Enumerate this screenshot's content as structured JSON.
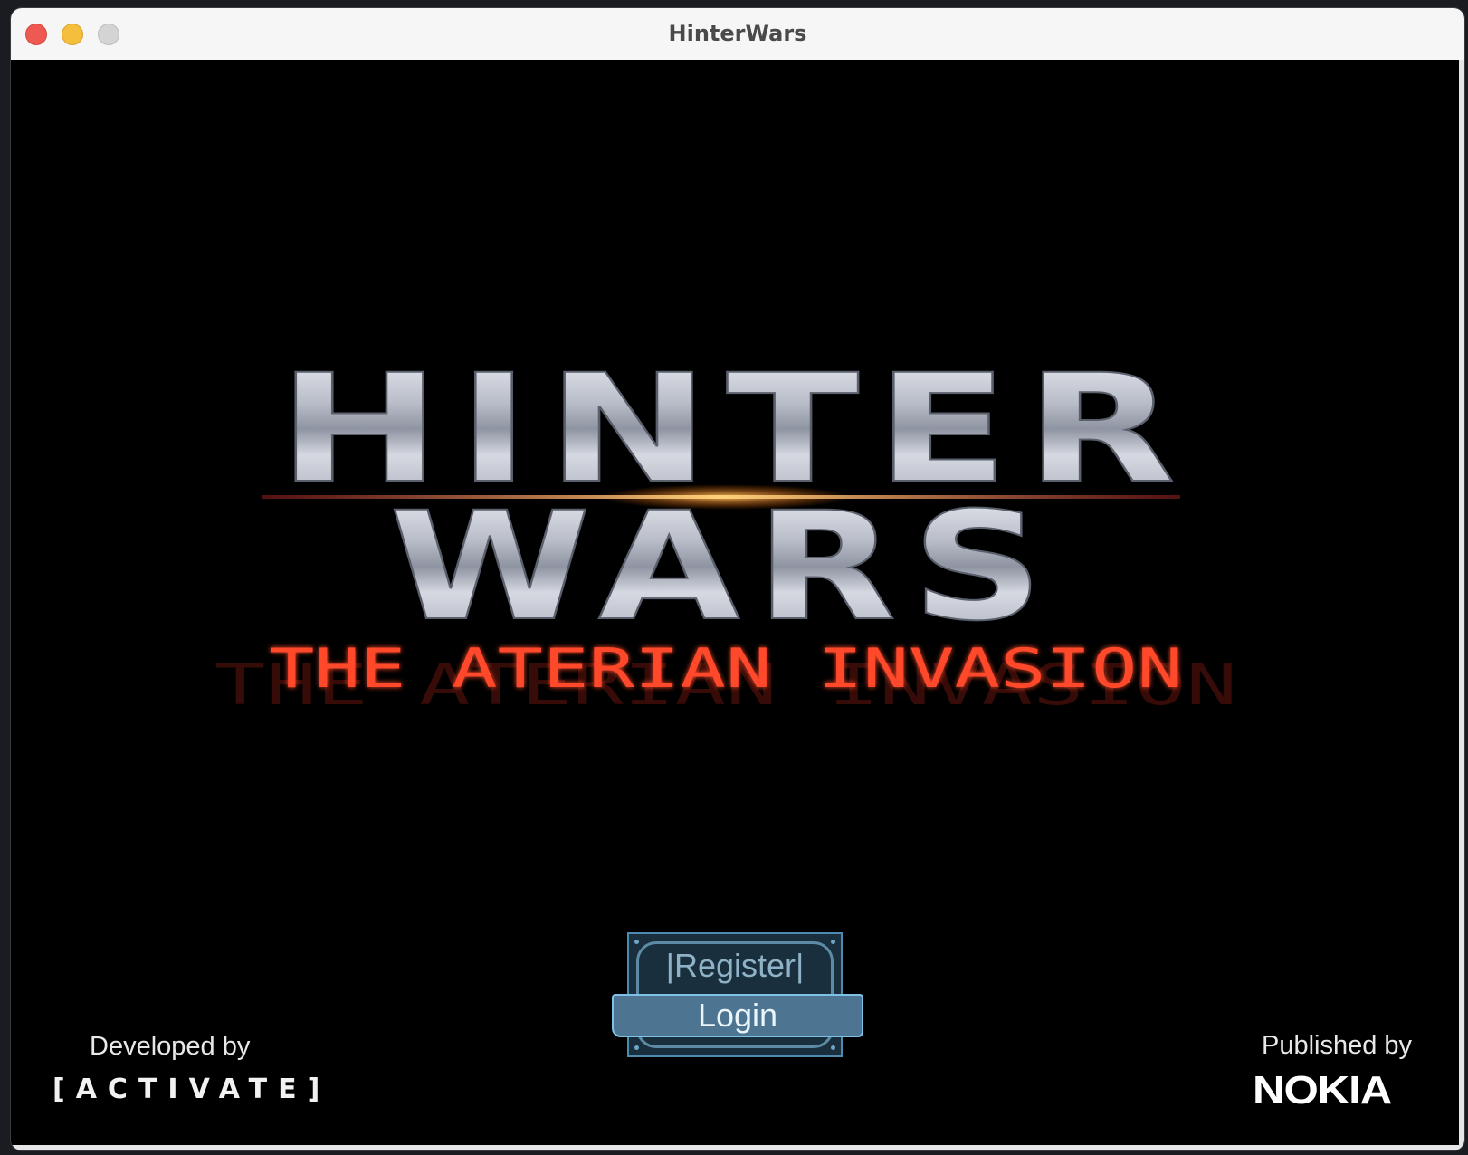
{
  "window": {
    "title": "HinterWars"
  },
  "logo": {
    "line1": "HINTER",
    "line2": "WARS",
    "subtitle": "THE ATERIAN INVASION"
  },
  "buttons": {
    "register_label": "|Register|",
    "login_label": "Login"
  },
  "credits": {
    "developed_by": "Developed by",
    "developer": "[ACTIVATE]",
    "published_by": "Published by",
    "publisher": "NOKIA"
  },
  "colors": {
    "logo_metal": "#c8ccd6",
    "subtitle_red": "#ff4a2a",
    "button_fill": "#4d7591",
    "button_border": "#7ec0e6"
  }
}
